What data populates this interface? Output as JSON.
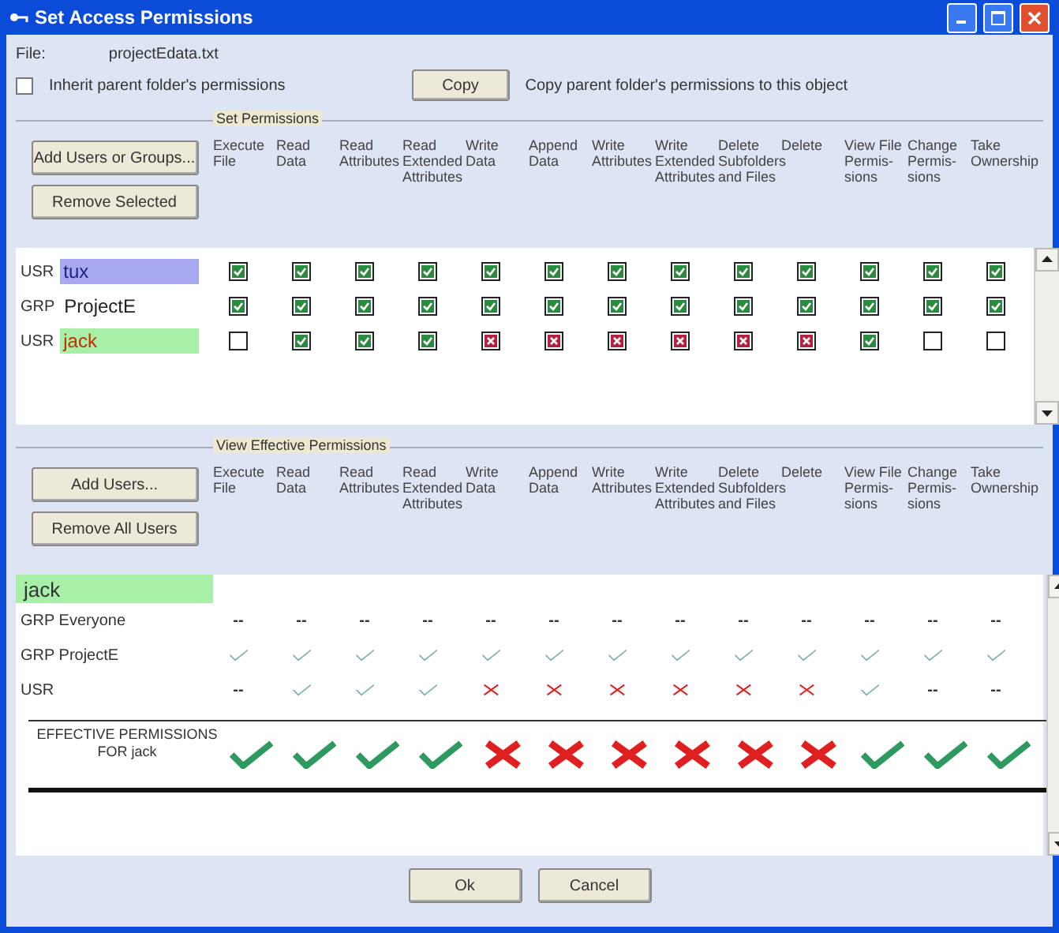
{
  "window": {
    "title": "Set Access Permissions"
  },
  "file": {
    "label": "File:",
    "value": "projectEdata.txt"
  },
  "inherit": {
    "label": "Inherit parent folder's permissions",
    "checked": false
  },
  "copy_button": "Copy",
  "copy_hint": "Copy parent folder's permissions to this object",
  "set_permissions": {
    "title": "Set Permissions",
    "buttons": [
      "Add Users or Groups...",
      "Remove Selected"
    ],
    "columns": [
      "Execute File",
      "Read Data",
      "Read Attributes",
      "Read Extended Attributes",
      "Write Data",
      "Append Data",
      "Write Attributes",
      "Write Extended Attributes",
      "Delete Subfolders and Files",
      "Delete",
      "View File Permis- sions",
      "Change Permis- sions",
      "Take Ownership"
    ],
    "rows": [
      {
        "prefix": "USR",
        "name": {
          "text": "tux",
          "color": "#202080"
        },
        "color": "#a8a8f0",
        "cells": [
          {
            "kind": "allow"
          },
          {
            "kind": "allow"
          },
          {
            "kind": "allow"
          },
          {
            "kind": "allow"
          },
          {
            "kind": "allow"
          },
          {
            "kind": "allow"
          },
          {
            "kind": "allow"
          },
          {
            "kind": "allow"
          },
          {
            "kind": "allow"
          },
          {
            "kind": "allow"
          },
          {
            "kind": "allow"
          },
          {
            "kind": "allow"
          },
          {
            "kind": "allow"
          }
        ]
      },
      {
        "prefix": "GRP",
        "name": {
          "text": "ProjectE"
        },
        "cells": [
          {
            "kind": "allow"
          },
          {
            "kind": "allow"
          },
          {
            "kind": "allow"
          },
          {
            "kind": "allow"
          },
          {
            "kind": "allow"
          },
          {
            "kind": "allow"
          },
          {
            "kind": "allow"
          },
          {
            "kind": "allow"
          },
          {
            "kind": "allow"
          },
          {
            "kind": "allow"
          },
          {
            "kind": "allow"
          },
          {
            "kind": "allow"
          },
          {
            "kind": "allow"
          }
        ]
      },
      {
        "prefix": "USR",
        "name": {
          "text": "jack",
          "color": "#c03000"
        },
        "color": "#a8f0a8",
        "cells": [
          {
            "kind": "none"
          },
          {
            "kind": "allow"
          },
          {
            "kind": "allow"
          },
          {
            "kind": "allow"
          },
          {
            "kind": "deny"
          },
          {
            "kind": "deny"
          },
          {
            "kind": "deny"
          },
          {
            "kind": "deny"
          },
          {
            "kind": "deny"
          },
          {
            "kind": "deny"
          },
          {
            "kind": "allow"
          },
          {
            "kind": "none"
          },
          {
            "kind": "none"
          }
        ]
      }
    ]
  },
  "effective_permissions": {
    "title": "View Effective Permissions",
    "buttons": [
      "Add Users...",
      "Remove All Users"
    ],
    "columns": [
      "Execute File",
      "Read Data",
      "Read Attributes",
      "Read Extended Attributes",
      "Write Data",
      "Append Data",
      "Write Attributes",
      "Write Extended Attributes",
      "Delete Subfolders and Files",
      "Delete",
      "View File Permis- sions",
      "Change Permis- sions",
      "Take Ownership"
    ],
    "user": {
      "name": "jack",
      "color": "#a8f0a8"
    },
    "rows": [
      {
        "label": "GRP Everyone",
        "cells": [
          {
            "kind": "text",
            "text": "--"
          },
          {
            "kind": "text",
            "text": "--"
          },
          {
            "kind": "text",
            "text": "--"
          },
          {
            "kind": "text",
            "text": "--"
          },
          {
            "kind": "text",
            "text": "--"
          },
          {
            "kind": "text",
            "text": "--"
          },
          {
            "kind": "text",
            "text": "--"
          },
          {
            "kind": "text",
            "text": "--"
          },
          {
            "kind": "text",
            "text": "--"
          },
          {
            "kind": "text",
            "text": "--"
          },
          {
            "kind": "text",
            "text": "--"
          },
          {
            "kind": "text",
            "text": "--"
          },
          {
            "kind": "text",
            "text": "--"
          }
        ]
      },
      {
        "label": "GRP ProjectE",
        "cells": [
          {
            "kind": "allow"
          },
          {
            "kind": "allow"
          },
          {
            "kind": "allow"
          },
          {
            "kind": "allow"
          },
          {
            "kind": "allow"
          },
          {
            "kind": "allow"
          },
          {
            "kind": "allow"
          },
          {
            "kind": "allow"
          },
          {
            "kind": "allow"
          },
          {
            "kind": "allow"
          },
          {
            "kind": "allow"
          },
          {
            "kind": "allow"
          },
          {
            "kind": "allow"
          }
        ]
      },
      {
        "label": "USR",
        "cells": [
          {
            "kind": "text",
            "text": "--"
          },
          {
            "kind": "allow"
          },
          {
            "kind": "allow"
          },
          {
            "kind": "allow"
          },
          {
            "kind": "deny"
          },
          {
            "kind": "deny"
          },
          {
            "kind": "deny"
          },
          {
            "kind": "deny"
          },
          {
            "kind": "deny"
          },
          {
            "kind": "deny"
          },
          {
            "kind": "allow"
          },
          {
            "kind": "text",
            "text": "--"
          },
          {
            "kind": "text",
            "text": "--"
          }
        ]
      }
    ],
    "result": {
      "label": "EFFECTIVE PERMISSIONS",
      "sublabel": "FOR jack",
      "cells": [
        {
          "kind": "allow"
        },
        {
          "kind": "allow"
        },
        {
          "kind": "allow"
        },
        {
          "kind": "allow"
        },
        {
          "kind": "deny"
        },
        {
          "kind": "deny"
        },
        {
          "kind": "deny"
        },
        {
          "kind": "deny"
        },
        {
          "kind": "deny"
        },
        {
          "kind": "deny"
        },
        {
          "kind": "allow"
        },
        {
          "kind": "allow"
        },
        {
          "kind": "allow"
        }
      ]
    }
  },
  "buttons": [
    "Ok",
    "Cancel"
  ]
}
